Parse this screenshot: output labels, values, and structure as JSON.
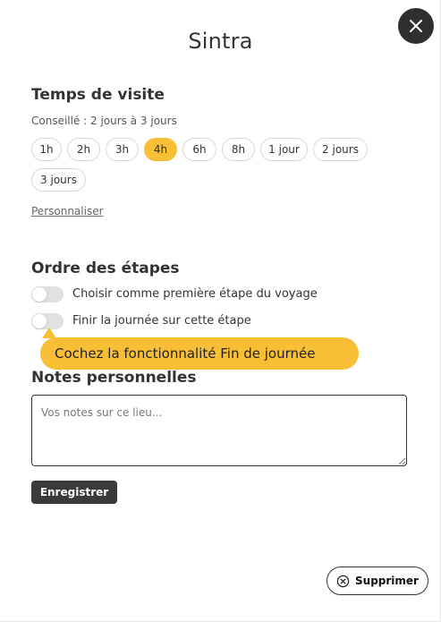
{
  "title": "Sintra",
  "visit": {
    "heading": "Temps de visite",
    "advice": "Conseillé : 2 jours à 3 jours",
    "options": [
      "1h",
      "2h",
      "3h",
      "4h",
      "6h",
      "8h",
      "1 jour",
      "2 jours",
      "3 jours"
    ],
    "selected": "4h",
    "customize_link": "Personnaliser"
  },
  "order": {
    "heading": "Ordre des étapes",
    "first_step_label": "Choisir comme première étape du voyage",
    "end_day_label": "Finir la journée sur cette étape"
  },
  "tooltip": {
    "text": "Cochez la fonctionnalité Fin de journée"
  },
  "notes": {
    "heading": "Notes personnelles",
    "placeholder": "Vos notes sur ce lieu...",
    "save_label": "Enregistrer"
  },
  "actions": {
    "delete_label": "Supprimer"
  },
  "colors": {
    "accent": "#f7be36",
    "dark": "#2f2f2f"
  },
  "icons": {
    "close": "close-icon",
    "delete": "circle-x-icon"
  }
}
